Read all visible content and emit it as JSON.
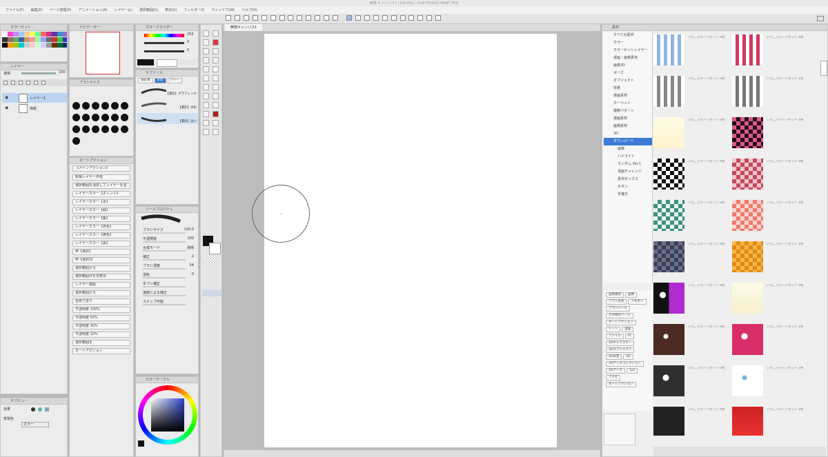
{
  "window": {
    "title": "無題-キャンバス1 (100.0%) - CLIP STUDIO PAINT PRO"
  },
  "menu": [
    "ファイル(F)",
    "編集(E)",
    "ページ管理(P)",
    "アニメーション(A)",
    "レイヤー(L)",
    "選択範囲(S)",
    "表示(V)",
    "フィルター(I)",
    "ウィンドウ(W)",
    "ヘルプ(H)"
  ],
  "canvas_tab": {
    "label": "無題キャンバス1"
  },
  "panels": {
    "color_set": {
      "title": "カラーセット"
    },
    "navigator": {
      "title": "ナビゲーター"
    },
    "color_slider": {
      "title": "カラースライダー",
      "values": [
        "255",
        "0",
        "0"
      ]
    },
    "layer": {
      "title": "レイヤー",
      "blend": "通常",
      "opacity": "100",
      "layers": [
        "用紙",
        "レイヤー1"
      ]
    },
    "brush_size": {
      "title": "ブラシサイズ"
    },
    "sub_tool": {
      "title": "サブツール",
      "tabs": [
        "油彩筆",
        "水彩",
        "ジャー"
      ],
      "items": [
        "【濃彩】グラフィック",
        "【濃彩】水彩",
        "【濃彩】淡い"
      ]
    },
    "tool_property": {
      "title": "ツールプロパティ",
      "rows": [
        {
          "label": "ブラシサイズ",
          "value": "100.0"
        },
        {
          "label": "不透明度",
          "value": "100"
        },
        {
          "label": "合成モード",
          "value": "通常"
        },
        {
          "label": "補正",
          "value": "2"
        },
        {
          "label": "ブラシ濃度",
          "value": "54"
        },
        {
          "label": "混色",
          "value": "0"
        },
        {
          "label": "手ブレ補正",
          "value": ""
        },
        {
          "label": "速度による補正",
          "value": ""
        },
        {
          "label": "スナップ可能",
          "value": ""
        }
      ]
    },
    "auto_action": {
      "title": "オートアクション",
      "set": "【メインアクション】",
      "items": [
        "新規レイヤー作成",
        "選択範囲を消去してレイヤーを塗",
        "レイヤーカラー【オレンジ】",
        "レイヤーカラー【青】",
        "レイヤーカラー【緑】",
        "レイヤーカラー【紫】",
        "レイヤーカラー【赤色】",
        "レイヤーカラー【黄色】",
        "レイヤーカラー【黒】",
        "枠【選択】",
        "枠【選択2】",
        "選択範囲から",
        "選択範囲外を非表示",
        "レイヤー複製",
        "選択範囲から",
        "自色で塗り",
        "不透明度 100%",
        "不透明度 50%",
        "不透明度 30%",
        "不透明度 10%",
        "選択範囲を",
        "オートアクション"
      ]
    },
    "color_wheel": {
      "title": "カラーサークル"
    },
    "small_panel": {
      "title": "サブビュー",
      "label1": "効果",
      "label2": "表現色",
      "value2": "カラー"
    },
    "material": {
      "title": "素材",
      "root": "すべての素材",
      "tree": [
        "カラー",
        "カラーセットレイヤー",
        "漫画・画像素材",
        "画像3D",
        "ポーズ",
        "オブジェクト",
        "背景",
        "漫画素材",
        "カーペット",
        "装飾パターン",
        "漫画素材",
        "画像素材",
        "3D",
        "ダウンロード",
        "画像",
        "ハイライト",
        "ランダム Ver.1",
        "漫画チャレンジ",
        "素材ボックス",
        "ボタン",
        "手描き"
      ],
      "tags": [
        "画像素材",
        "画像",
        "ブラシ形状",
        "フキダシ",
        "ブラシツール",
        "その他のツール",
        "オートアクション",
        "トーン",
        "漫画",
        "ファイル",
        "円",
        "3Dキャラクター",
        "3Dオブジェクト",
        "3D背景",
        "3D",
        "3Dデータコレクション",
        "3Dデータ",
        "1px",
        "アクセ",
        "オートアクション"
      ],
      "item_caption": "いちごパターンセット 8色"
    }
  },
  "colors": {
    "accent": "#3b7bd6",
    "canvas_bg": "#ffffff",
    "workspace": "#b8b8b8",
    "material_pink": "#d2375f",
    "material_orange": "#e08a12"
  }
}
